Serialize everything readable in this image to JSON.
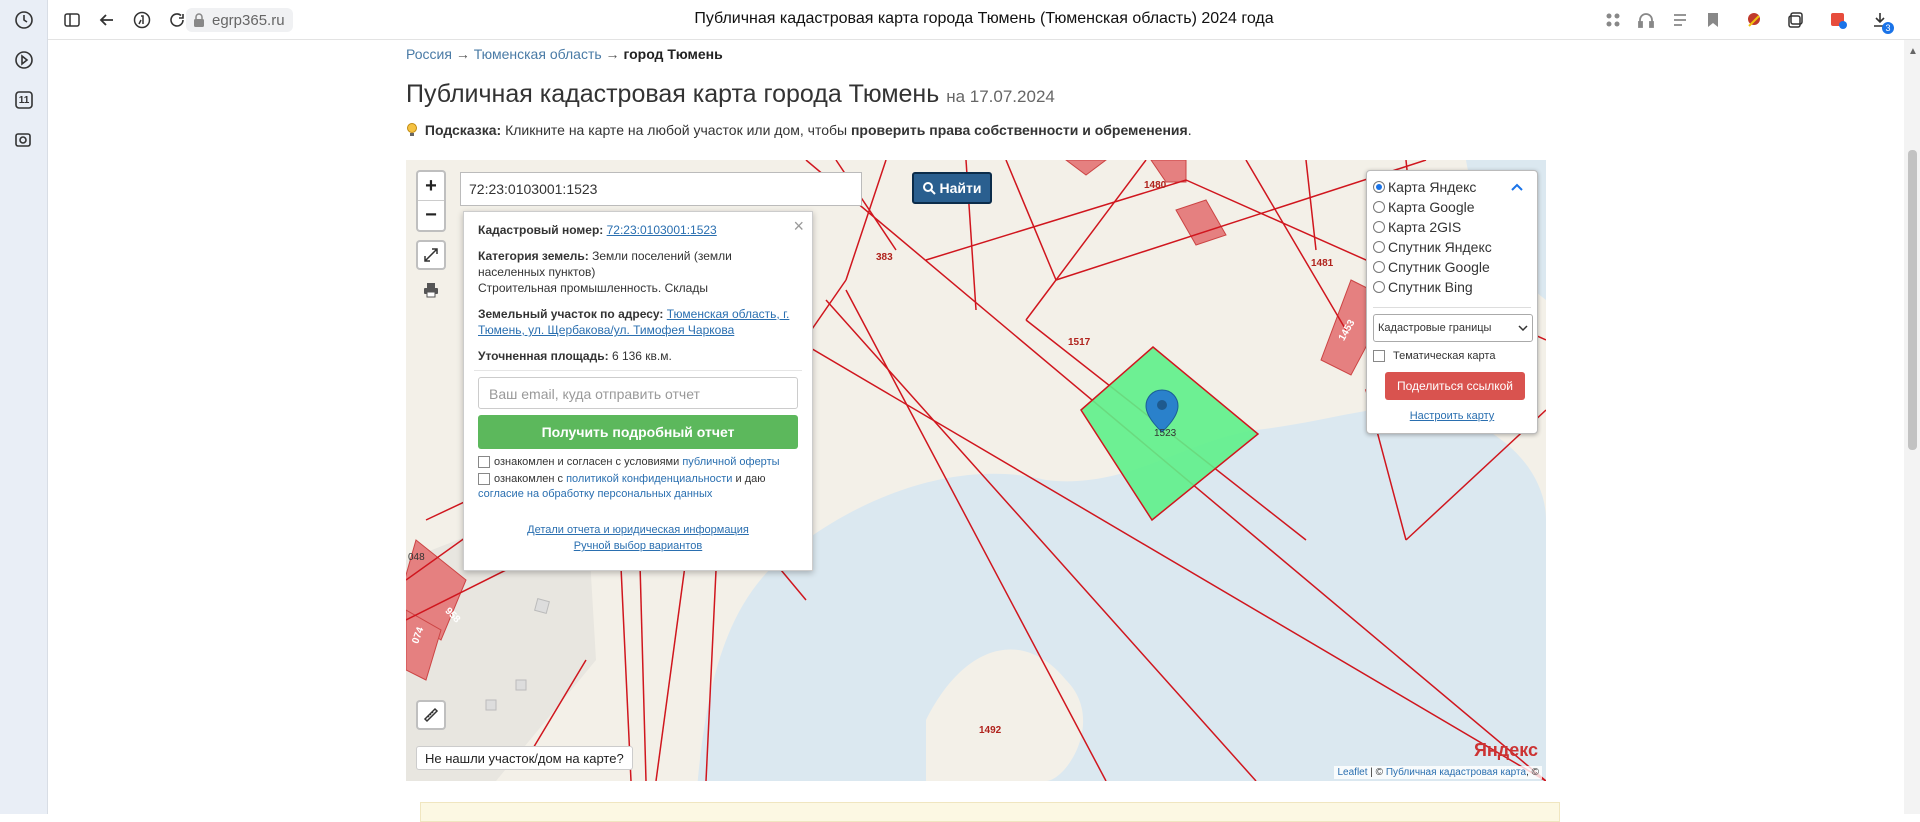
{
  "browser": {
    "url": "egrp365.ru",
    "tab_title": "Публичная кадастровая карта города Тюмень (Тюменская область) 2024 года",
    "rail_badge": "11",
    "download_badge": "3"
  },
  "breadcrumb": {
    "items": [
      "Россия",
      "Тюменская область"
    ],
    "current": "город Тюмень",
    "separator": "→"
  },
  "page": {
    "title": "Публичная кадастровая карта города Тюмень",
    "date": "на 17.07.2024",
    "hint_label": "Подсказка:",
    "hint_text": "Кликните на карте на любой участок или дом, чтобы",
    "hint_bold": "проверить права собственности и обременения",
    "hint_end": "."
  },
  "map": {
    "search_value": "72:23:0103001:1523",
    "find_label": "Найти",
    "zoom_in": "+",
    "zoom_out": "−",
    "not_found": "Не нашли участок/дом на карте?",
    "yandex_logo": "Яндекс",
    "attribution_leaflet": "Leaflet",
    "attribution_sep": "| ©",
    "attribution_map": "Публичная кадастровая карта",
    "attribution_end": ", ©",
    "parcel_labels": [
      "1480",
      "383",
      "1481",
      "1517",
      "1523",
      "1453",
      "1492",
      "048",
      "958",
      "074"
    ]
  },
  "popup": {
    "cadnum_label": "Кадастровый номер:",
    "cadnum_value": "72:23:0103001:1523",
    "category_label": "Категория земель:",
    "category_value": "Земли поселений (земли населенных пунктов)",
    "category_use": "Строительная промышленность. Склады",
    "address_label": "Земельный участок по адресу:",
    "address_value": "Тюменская область, г. Тюмень, ул. Щербакова/ул. Тимофея Чаркова",
    "area_label": "Уточненная площадь:",
    "area_value": "6 136 кв.м.",
    "email_placeholder": "Ваш email, куда отправить отчет",
    "report_button": "Получить подробный отчет",
    "check1_text": "ознакомлен и согласен с условиями",
    "check1_link": "публичной оферты",
    "check2_text": "ознакомлен с",
    "check2_link": "политикой конфиденциальности",
    "check2_text2": "и даю",
    "check2_link2": "согласие на обработку персональных данных",
    "details_link": "Детали отчета и юридическая информация",
    "manual_link": "Ручной выбор вариантов"
  },
  "layers": {
    "options": [
      "Карта Яндекс",
      "Карта Google",
      "Карта 2GIS",
      "Спутник Яндекс",
      "Спутник Google",
      "Спутник Bing"
    ],
    "selected": "Карта Яндекс",
    "overlay_select": "Кадастровые границы",
    "thematic_label": "Тематическая карта",
    "share_button": "Поделиться ссылкой",
    "setup_link": "Настроить карту"
  },
  "colors": {
    "parcel_border": "#d0161e",
    "selected_parcel": "#5ef08a",
    "water": "#dbe8f0",
    "find_button": "#2a5f8f",
    "report_button": "#5cb85c",
    "share_button": "#d9534f"
  }
}
